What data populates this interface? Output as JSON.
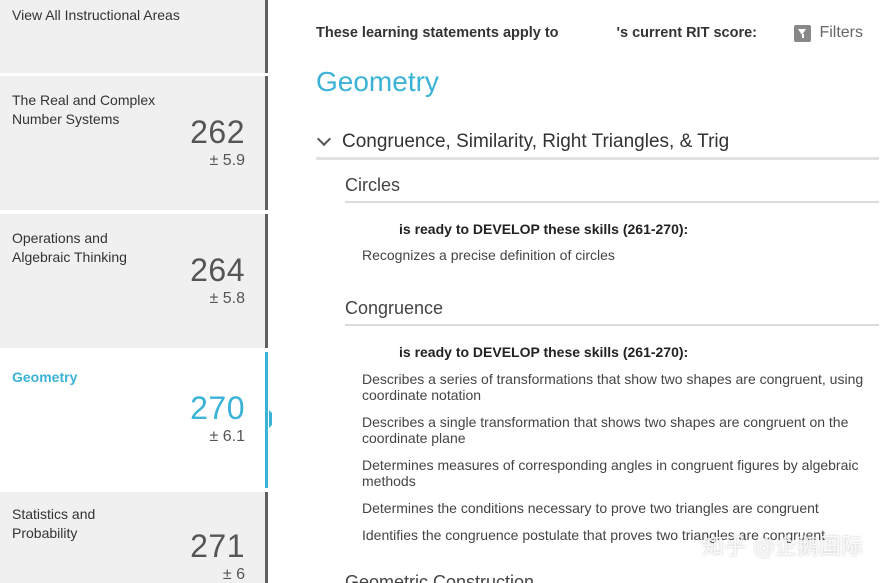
{
  "sidebar": {
    "view_all": "View All Instructional Areas",
    "items": [
      {
        "name_line1": "The Real and Complex",
        "name_line2": "Number Systems",
        "score": "262",
        "error": "± 5.9"
      },
      {
        "name_line1": "Operations and",
        "name_line2": "Algebraic Thinking",
        "score": "264",
        "error": "± 5.8"
      },
      {
        "name_line1": "Geometry",
        "name_line2": "",
        "score": "270",
        "error": "± 6.1"
      },
      {
        "name_line1": "Statistics and",
        "name_line2": "Probability",
        "score": "271",
        "error": "± 6"
      }
    ]
  },
  "header": {
    "statement_prefix": "These learning statements apply to",
    "statement_suffix": "'s current RIT score:",
    "filters_label": "Filters"
  },
  "main": {
    "area_title": "Geometry",
    "section_title": "Congruence, Similarity, Right Triangles, & Trig",
    "subsections": [
      {
        "title": "Circles",
        "ready_text": "is ready to DEVELOP these skills (261-270):",
        "statements": [
          "Recognizes a precise definition of circles"
        ]
      },
      {
        "title": "Congruence",
        "ready_text": "is ready to DEVELOP these skills (261-270):",
        "statements": [
          "Describes a series of transformations that show two shapes are congruent, using coordinate notation",
          "Describes a single transformation that shows two shapes are congruent on the coordinate plane",
          "Determines measures of corresponding angles in congruent figures by algebraic methods",
          "Determines the conditions necessary to prove two triangles are congruent",
          "Identifies the congruence postulate that proves two triangles are congruent"
        ]
      }
    ],
    "next_subsection_partial": "Geometric Construction"
  },
  "watermark": "知乎 @企鹅国际",
  "colors": {
    "accent": "#3ab3d6",
    "card_bg": "#f0f0f0",
    "card_border": "#606060"
  }
}
